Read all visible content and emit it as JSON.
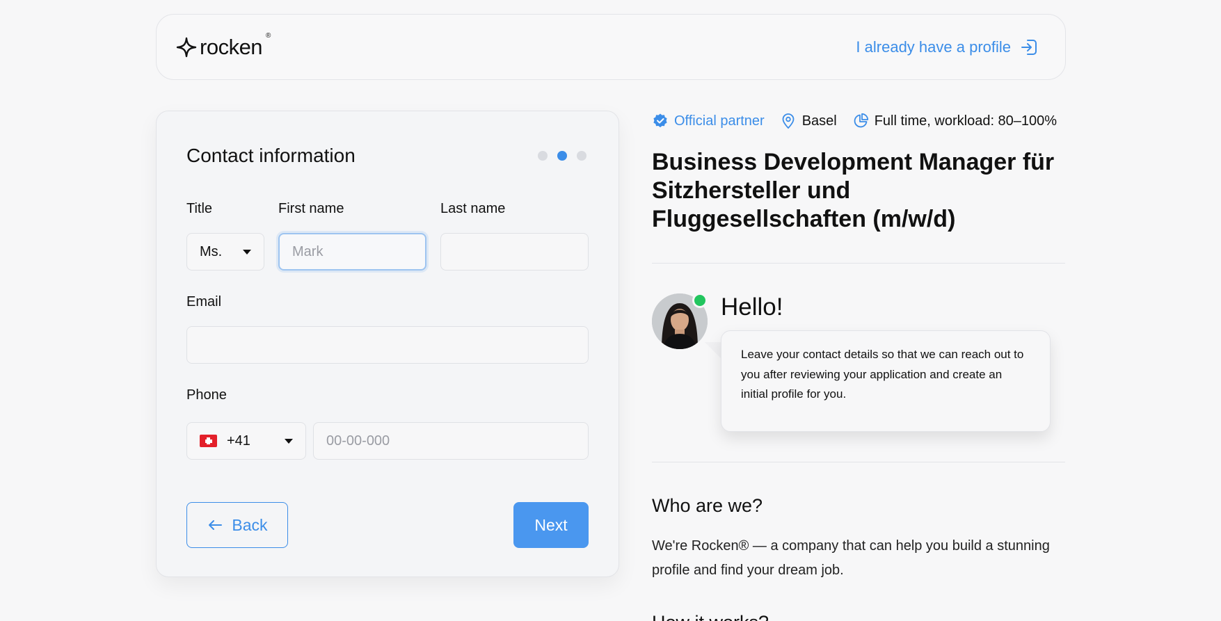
{
  "header": {
    "logo_text": "rocken",
    "logo_reg": "®",
    "login_link": "I already have a profile"
  },
  "form": {
    "title": "Contact information",
    "steps": {
      "total": 3,
      "current": 2
    },
    "title_label": "Title",
    "title_value": "Ms.",
    "first_name_label": "First name",
    "first_name_placeholder": "Mark",
    "last_name_label": "Last name",
    "email_label": "Email",
    "phone_label": "Phone",
    "phone_code": "+41",
    "phone_placeholder": "00-00-000",
    "back_label": "Back",
    "next_label": "Next"
  },
  "job": {
    "partner": "Official partner",
    "location": "Basel",
    "workload": "Full time, workload: 80–100%",
    "title": "Business Development Manager für Sitzhersteller und Fluggesellschaften (m/w/d)"
  },
  "recruiter": {
    "greeting": "Hello!",
    "message": "Leave your contact details so that we can reach out to you after reviewing your application and create an initial profile for you."
  },
  "about": {
    "heading": "Who are we?",
    "text": "We're Rocken® — a company that can help you build a stunning profile and find your dream job.",
    "next_heading": "How it works?"
  },
  "colors": {
    "accent": "#3b8de8",
    "online": "#22c55e"
  },
  "icons": {
    "logo": "sparkle-star-icon",
    "login": "sign-in-arrow-icon",
    "partner": "verified-badge-icon",
    "location": "map-pin-icon",
    "workload": "pie-chart-icon",
    "back": "arrow-left-icon"
  }
}
